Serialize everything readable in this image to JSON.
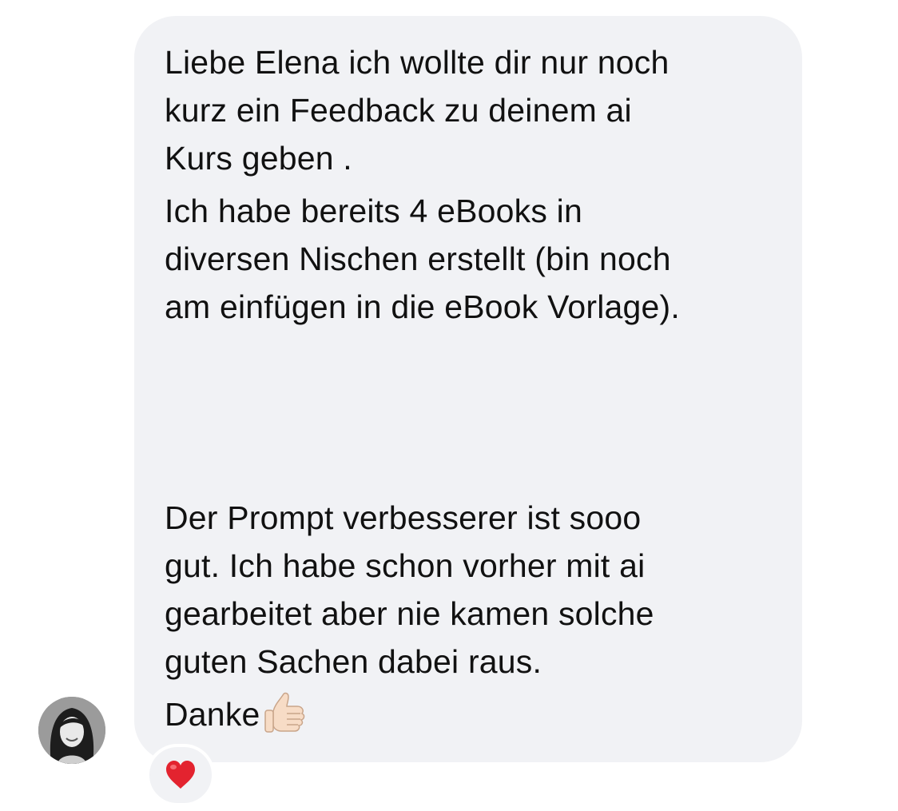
{
  "message": {
    "paragraph_1": "Liebe Elena ich wollte dir nur noch\nkurz ein Feedback zu deinem ai\nKurs geben .",
    "paragraph_2": "Ich habe bereits 4 eBooks in\ndiversen Nischen erstellt (bin noch\nam einfügen in die eBook Vorlage).",
    "paragraph_3": "Der Prompt verbesserer ist sooo\ngut. Ich habe schon vorher mit ai\ngearbeitet aber nie kamen solche\nguten Sachen dabei raus.",
    "closing": "Danke",
    "closing_emoji": "thumbs-up-icon"
  },
  "reaction": {
    "emoji": "red-heart-icon"
  },
  "colors": {
    "bubble_background": "#f1f2f5",
    "text": "#111111",
    "heart": "#e3232f"
  }
}
